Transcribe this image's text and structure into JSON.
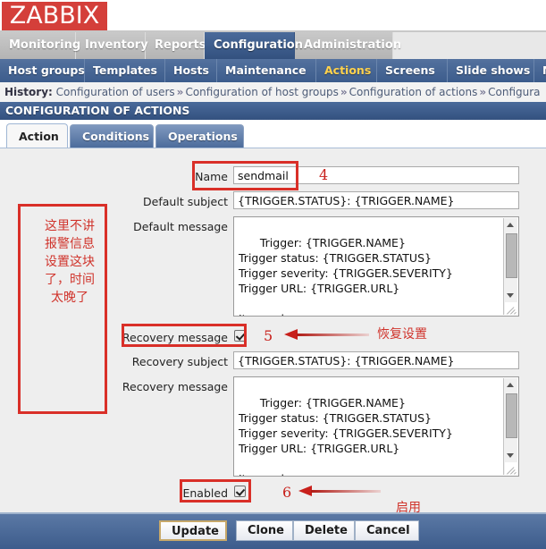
{
  "brand": {
    "logo_text": "ZABBIX",
    "logo_bg": "#d43f3a"
  },
  "main_menu": [
    {
      "label": "Monitoring",
      "active": false
    },
    {
      "label": "Inventory",
      "active": false
    },
    {
      "label": "Reports",
      "active": false
    },
    {
      "label": "Configuration",
      "active": true
    },
    {
      "label": "Administration",
      "active": false
    }
  ],
  "sub_menu": [
    {
      "label": "Host groups",
      "active": false
    },
    {
      "label": "Templates",
      "active": false
    },
    {
      "label": "Hosts",
      "active": false
    },
    {
      "label": "Maintenance",
      "active": false
    },
    {
      "label": "Actions",
      "active": true
    },
    {
      "label": "Screens",
      "active": false
    },
    {
      "label": "Slide shows",
      "active": false
    },
    {
      "label": "M",
      "active": false
    }
  ],
  "history": {
    "label": "History:",
    "items": [
      "Configuration of users",
      "Configuration of host groups",
      "Configuration of actions",
      "Configura"
    ],
    "separator": "»"
  },
  "page_title": "CONFIGURATION OF ACTIONS",
  "tabs": [
    {
      "label": "Action",
      "active": true
    },
    {
      "label": "Conditions",
      "active": false
    },
    {
      "label": "Operations",
      "active": false
    }
  ],
  "form": {
    "name": {
      "label": "Name",
      "value": "sendmail"
    },
    "default_subject": {
      "label": "Default subject",
      "value": "{TRIGGER.STATUS}: {TRIGGER.NAME}"
    },
    "default_message": {
      "label": "Default message",
      "value": "Trigger: {TRIGGER.NAME}\nTrigger status: {TRIGGER.STATUS}\nTrigger severity: {TRIGGER.SEVERITY}\nTrigger URL: {TRIGGER.URL}\n\nItem values:"
    },
    "recovery_message": {
      "label": "Recovery message",
      "checked": true
    },
    "recovery_subject": {
      "label": "Recovery subject",
      "value": "{TRIGGER.STATUS}: {TRIGGER.NAME}"
    },
    "recovery_message_body": {
      "label": "Recovery message",
      "value": "Trigger: {TRIGGER.NAME}\nTrigger status: {TRIGGER.STATUS}\nTrigger severity: {TRIGGER.SEVERITY}\nTrigger URL: {TRIGGER.URL}\n\nItem values:"
    },
    "enabled": {
      "label": "Enabled",
      "checked": true
    }
  },
  "buttons": [
    {
      "label": "Update",
      "primary": true
    },
    {
      "label": "Clone",
      "primary": false
    },
    {
      "label": "Delete",
      "primary": false
    },
    {
      "label": "Cancel",
      "primary": false
    }
  ],
  "annotations": {
    "color": "#d92f28",
    "note_left": "这里不讲\n报警信息\n设置这块\n了，时间\n太晚了",
    "num_4": "4",
    "num_5": "5",
    "num_6": "6",
    "label_recovery": "恢复设置",
    "label_enabled": "启用"
  }
}
